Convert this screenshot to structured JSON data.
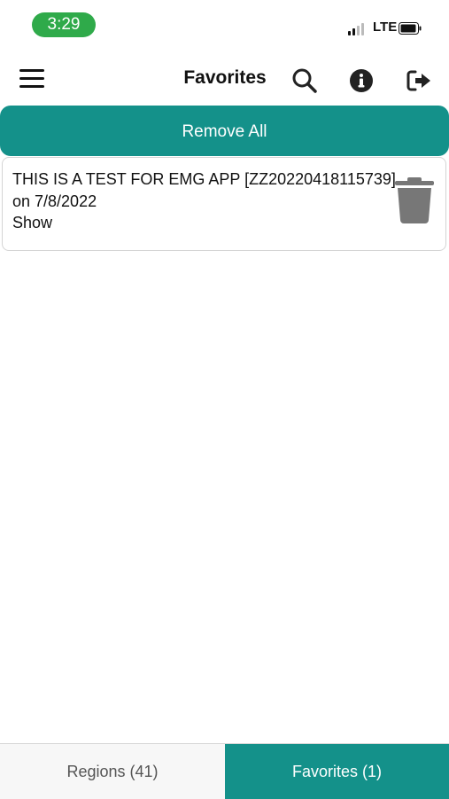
{
  "status_bar": {
    "time": "3:29",
    "network": "LTE",
    "icons": [
      "signal-icon",
      "battery-icon"
    ]
  },
  "header": {
    "title": "Favorites",
    "icons": [
      "menu-icon",
      "search-icon",
      "info-icon",
      "logout-icon"
    ]
  },
  "actions": {
    "remove_all": "Remove All"
  },
  "favorites": [
    {
      "title": "THIS IS A TEST FOR EMG APP [ZZ20220418115739]",
      "date_line": "on 7/8/2022",
      "action": "Show",
      "icon": "trash-icon"
    }
  ],
  "tabs": [
    {
      "label": "Regions (41)",
      "active": false
    },
    {
      "label": "Favorites (1)",
      "active": true
    }
  ],
  "colors": {
    "accent": "#14918a",
    "status_pill": "#2faa4a",
    "trash": "#777777"
  }
}
